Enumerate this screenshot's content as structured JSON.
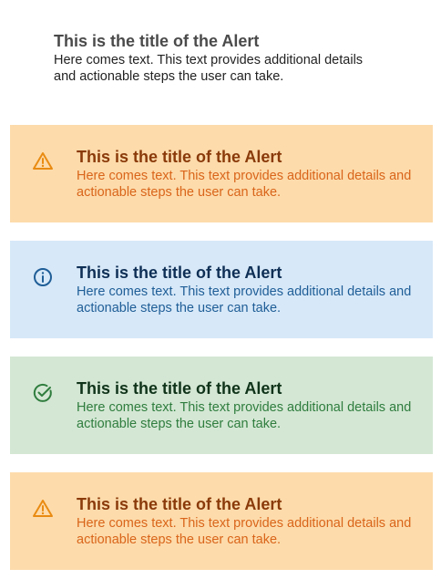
{
  "plain_alert": {
    "title": "This is the title of the Alert",
    "text": "Here comes text. This text provides additional details and actionable steps the user can take."
  },
  "alerts": [
    {
      "variant": "warning",
      "icon": "warning-triangle-icon",
      "color": "#e98b12",
      "title": "This is the title of the Alert",
      "text": "Here comes text. This text provides additional details and actionable steps the user can take."
    },
    {
      "variant": "info",
      "icon": "info-circle-icon",
      "color": "#1f5e97",
      "title": "This is the title of the Alert",
      "text": "Here comes text. This text provides additional details and actionable steps the user can take."
    },
    {
      "variant": "success",
      "icon": "check-circle-icon",
      "color": "#2f7d3e",
      "title": "This is the title of the Alert",
      "text": "Here comes text. This text provides additional details and actionable steps the user can take."
    },
    {
      "variant": "warning",
      "icon": "warning-triangle-icon",
      "color": "#e98b12",
      "title": "This is the title of the Alert",
      "text": "Here comes text. This text provides additional details and actionable steps the user can take."
    }
  ]
}
